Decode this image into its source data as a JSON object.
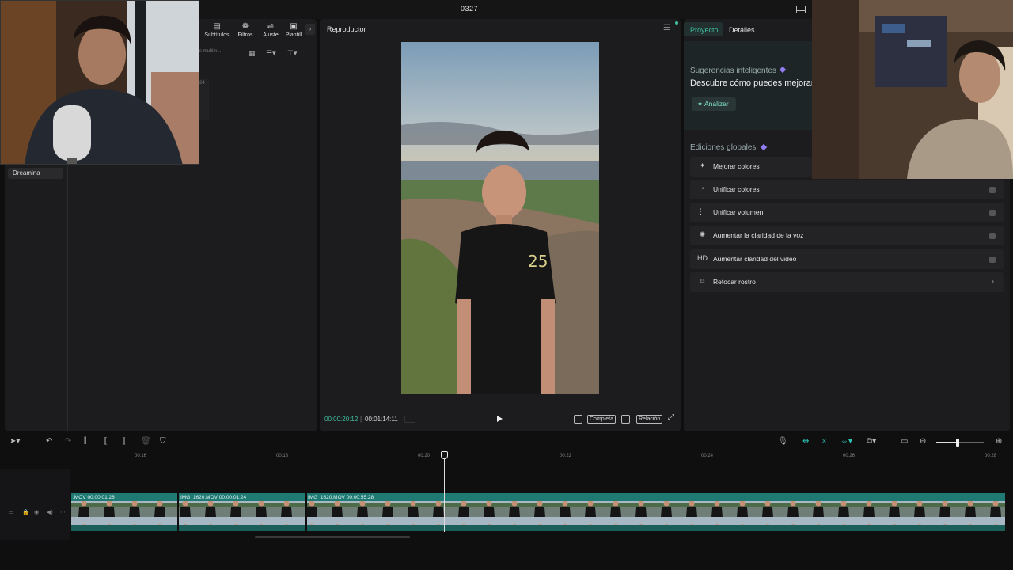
{
  "window": {
    "title": "0327"
  },
  "media_panel": {
    "tools": [
      {
        "label": "Subtítulos",
        "icon": "subtitles-icon"
      },
      {
        "label": "Filtros",
        "icon": "filters-icon"
      },
      {
        "label": "Ajuste",
        "icon": "adjust-icon"
      },
      {
        "label": "Plantill",
        "icon": "templates-icon"
      }
    ],
    "search_placeholder": "s multim...",
    "side_number": "24",
    "sidebar": {
      "active_item": "Dreamina"
    }
  },
  "player": {
    "title": "Reproductor",
    "current_time": "00:00:20:12",
    "separator": "|",
    "total_time": "00:01:14:11",
    "complete_label": "Completa",
    "ratio_label": "Relación"
  },
  "right_panel": {
    "tabs": [
      "Proyecto",
      "Detalles"
    ],
    "smart_suggestions": {
      "title": "Sugerencias inteligentes",
      "text": "Descubre cómo puedes mejorar",
      "analyze_label": "Analizar"
    },
    "global_edits": {
      "title": "Ediciones globales",
      "items": [
        {
          "label": "Mejorar colores",
          "icon": "enhance-colors-icon",
          "glyph": "✦"
        },
        {
          "label": "Unificar colores",
          "icon": "unify-colors-icon",
          "glyph": "◔"
        },
        {
          "label": "Unificar volumen",
          "icon": "volume-sliders-icon",
          "glyph": "⋮⋮"
        },
        {
          "label": "Aumentar la claridad de la voz",
          "icon": "voice-clarity-icon",
          "glyph": "✺"
        },
        {
          "label": "Aumentar claridad del video",
          "icon": "hd-icon",
          "glyph": "HD"
        },
        {
          "label": "Retocar rostro",
          "icon": "face-retouch-icon",
          "glyph": "☺"
        }
      ]
    }
  },
  "timeline": {
    "ticks": [
      "00:16",
      "00:18",
      "00:20",
      "00:22",
      "00:24",
      "00:26",
      "00:28"
    ],
    "clips": [
      {
        "name": ".MOV",
        "duration": "00:00:01:26"
      },
      {
        "name": "IMG_1620.MOV",
        "duration": "00:00:01:24"
      },
      {
        "name": "IMG_1620.MOV",
        "duration": "00:00:55:28"
      }
    ]
  },
  "colors": {
    "accent": "#3fbf9f",
    "clip": "#1f7a73",
    "panel": "#1c1c1e"
  }
}
